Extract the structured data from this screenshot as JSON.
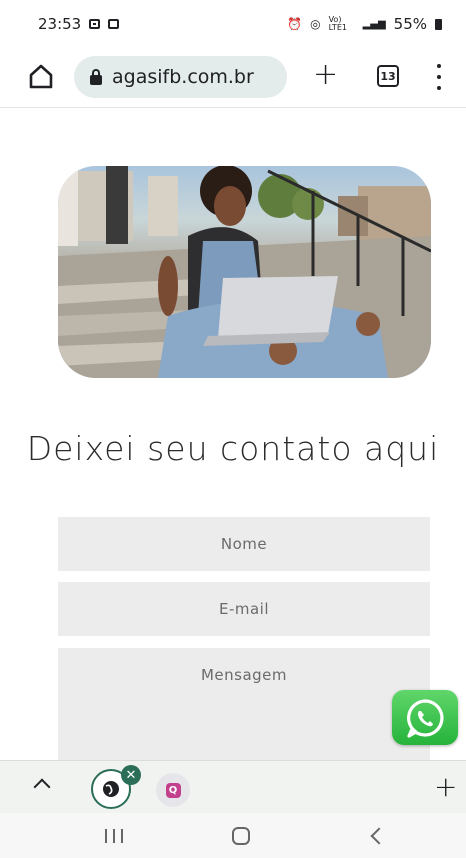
{
  "status_bar": {
    "time": "23:53",
    "battery": "55%",
    "network": "Vo) LTE1",
    "icons": [
      "gallery-icon",
      "notification-icon",
      "alarm-icon",
      "hotspot-icon",
      "signal-icon",
      "battery-icon"
    ]
  },
  "browser": {
    "url": "agasifb.com.br",
    "tab_count": "13"
  },
  "page": {
    "heading": "Deixei seu contato aqui",
    "form": {
      "name_placeholder": "Nome",
      "email_placeholder": "E-mail",
      "message_placeholder": "Mensagem"
    }
  },
  "colors": {
    "accent_green": "#2b6e58",
    "whatsapp_green": "#25d366",
    "field_bg": "#ececec"
  }
}
